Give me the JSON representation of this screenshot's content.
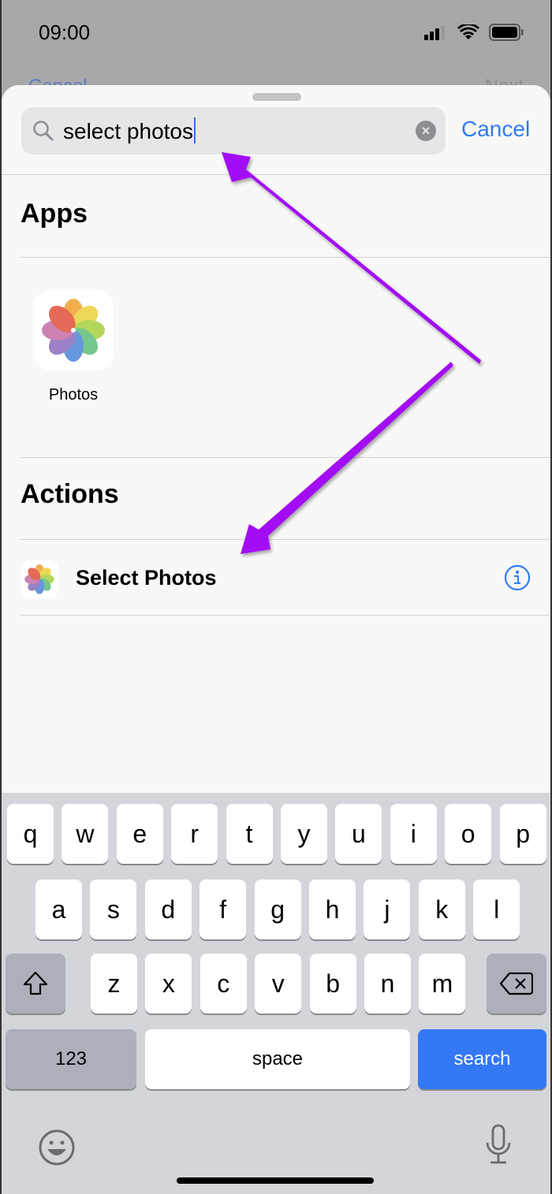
{
  "status_bar": {
    "time": "09:00",
    "icons": [
      "signal-icon",
      "wifi-icon",
      "battery-icon"
    ]
  },
  "background_nav": {
    "left": "Cancel",
    "right": "Next"
  },
  "search": {
    "value": "select photos",
    "cancel_label": "Cancel"
  },
  "sections": {
    "apps": {
      "title": "Apps",
      "items": [
        {
          "label": "Photos",
          "icon": "photos-app-icon"
        }
      ]
    },
    "actions": {
      "title": "Actions",
      "items": [
        {
          "label": "Select Photos",
          "icon": "photos-app-icon",
          "info": "info-icon"
        }
      ]
    }
  },
  "keyboard": {
    "row1": [
      "q",
      "w",
      "e",
      "r",
      "t",
      "y",
      "u",
      "i",
      "o",
      "p"
    ],
    "row2": [
      "a",
      "s",
      "d",
      "f",
      "g",
      "h",
      "j",
      "k",
      "l"
    ],
    "row3": [
      "z",
      "x",
      "c",
      "v",
      "b",
      "n",
      "m"
    ],
    "numbers_label": "123",
    "space_label": "space",
    "search_label": "search"
  },
  "colors": {
    "accent": "#2f7cf6",
    "annotation_arrow": "#a310f5",
    "search_key": "#3478f6"
  }
}
